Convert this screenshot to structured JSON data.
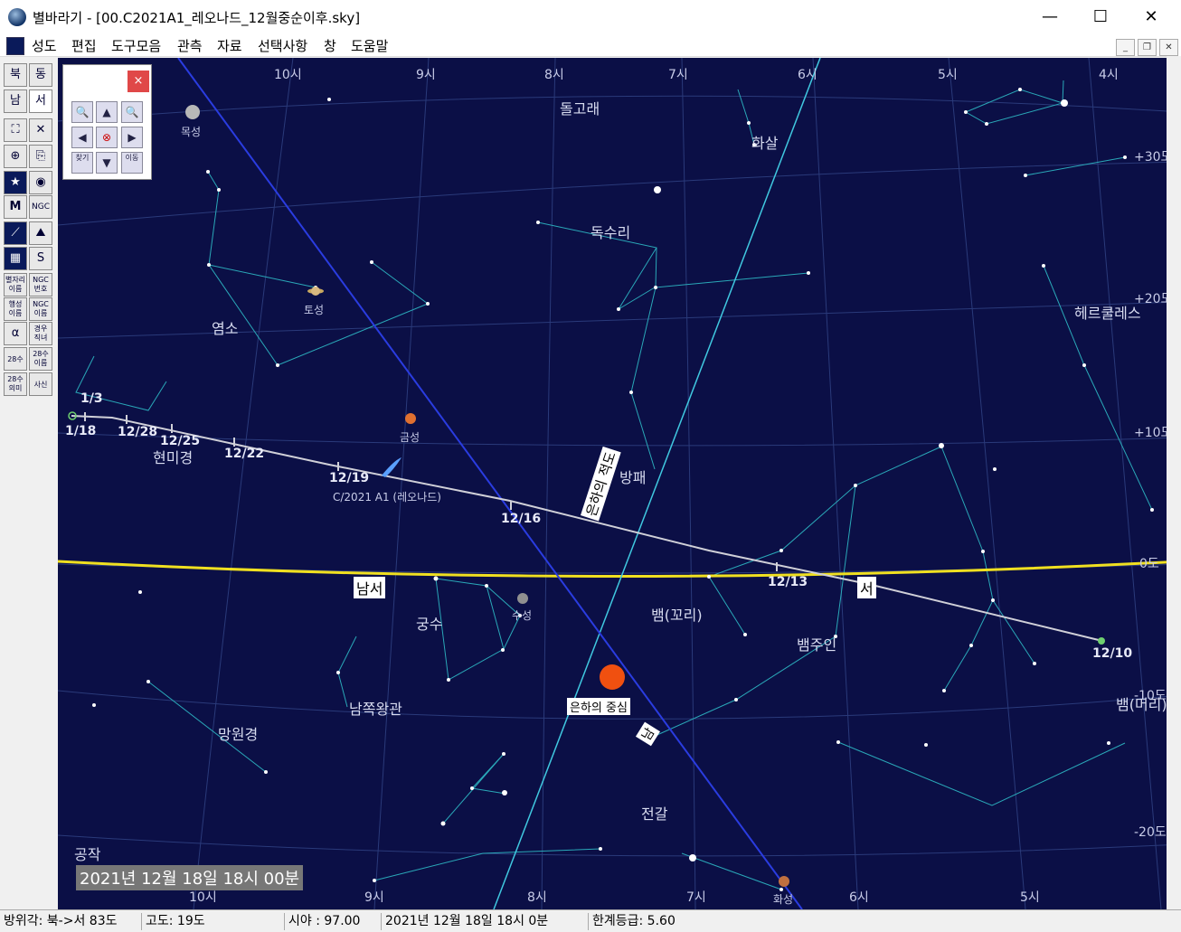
{
  "window": {
    "title": "별바라기 - [00.C2021A1_레오나드_12월중순이후.sky]",
    "minimize": "—",
    "maximize": "☐",
    "close": "✕"
  },
  "menu": [
    "성도",
    "편집",
    "도구모음",
    "관측",
    "자료",
    "선택사항",
    "창",
    "도움말"
  ],
  "toolbar": [
    [
      "북",
      "동"
    ],
    [
      "남",
      "서"
    ],
    [
      "⛶",
      "✕"
    ],
    [
      "⊕",
      "⎘"
    ],
    [
      "★",
      "◉"
    ],
    [
      "M",
      "NGC"
    ],
    [
      "⟋",
      "⛰"
    ],
    [
      "▦",
      "S"
    ],
    [
      "별자리 이름",
      "NGC 번호"
    ],
    [
      "행성 이름",
      "NGC 이름"
    ],
    [
      "α",
      "경우 직녀"
    ],
    [
      "28수",
      "28수 이름"
    ],
    [
      "28수 의미",
      "사신"
    ]
  ],
  "control_panel": {
    "close": "×",
    "buttons": [
      "🔍",
      "▲",
      "🔍",
      "◀",
      "⊗",
      "▶",
      "찾기",
      "▼",
      "이동"
    ]
  },
  "sky": {
    "hour_top": [
      "10시",
      "9시",
      "8시",
      "7시",
      "6시",
      "5시",
      "4시"
    ],
    "hour_bottom": [
      "10시",
      "9시",
      "8시",
      "7시",
      "6시",
      "5시"
    ],
    "dec": [
      "+30도",
      "+20도",
      "+10도",
      "0도",
      "-10도",
      "-20도"
    ],
    "constellations": [
      "돌고래",
      "화살",
      "독수리",
      "헤르쿨레스",
      "염소",
      "현미경",
      "방패",
      "궁수",
      "뱀(꼬리)",
      "뱀주인",
      "남쪽왕관",
      "망원경",
      "전갈",
      "뱀(머리)",
      "공작"
    ],
    "planets": [
      "목성",
      "토성",
      "금성",
      "수성",
      "화성"
    ],
    "comet": "C/2021 A1 (레오나드)",
    "comet_dates": [
      "1/3",
      "1/18",
      "12/28",
      "12/25",
      "12/22",
      "12/19",
      "12/16",
      "12/13",
      "12/10"
    ],
    "boxed": {
      "ecliptic": "남서",
      "west": "서",
      "milkyway": "은하의 중심",
      "galactic_equator": "은하의 적도",
      "cardinal": "남"
    },
    "overlay_date": "2021년 12월 18일 18시 00분"
  },
  "status": {
    "azimuth": "방위각: 북->서  83도",
    "altitude": "고도:  19도",
    "fov": "시야 : 97.00",
    "datetime": "2021년 12월 18일 18시  0분",
    "limit_mag": "한계등급:  5.60"
  }
}
